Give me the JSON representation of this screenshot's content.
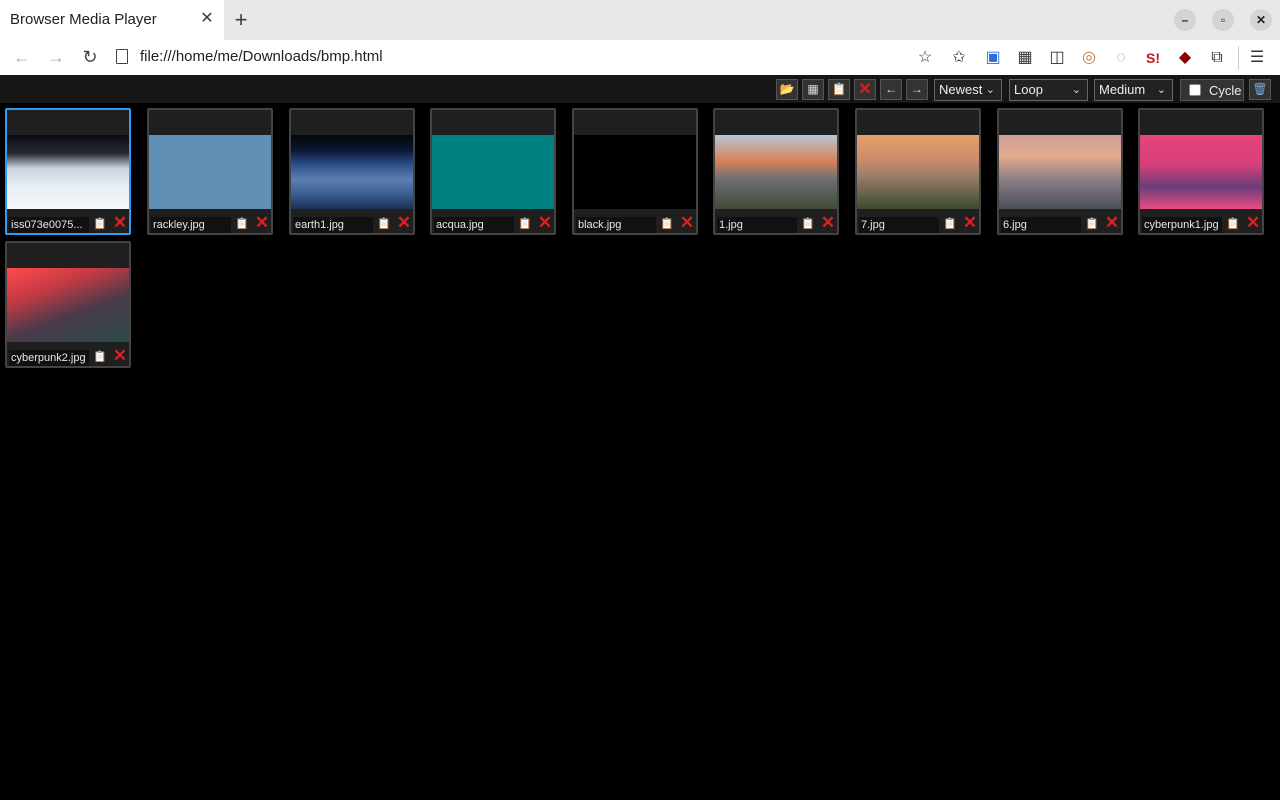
{
  "browser": {
    "tab_title": "Browser Media Player",
    "tab_close": "✕",
    "new_tab": "+",
    "url": "file:///home/me/Downloads/bmp.html",
    "window": {
      "minimize": "–",
      "maximize": "▫",
      "close": "✕"
    },
    "nav": {
      "back": "←",
      "forward": "→",
      "reload": "↻"
    },
    "extensions": [
      "☆",
      "✩",
      "▣",
      "▦",
      "◫",
      "◎",
      "◌",
      "S!",
      "◆",
      "⧉",
      "☰"
    ]
  },
  "controls": {
    "open_folder_icon": "📂",
    "grid_icon": "▦",
    "clipboard_icon": "📋",
    "clear_icon": "✕",
    "prev_icon": "←",
    "next_icon": "→",
    "sort": "Newest",
    "mode": "Loop",
    "size": "Medium",
    "cycle_label": "Cycle",
    "trash_icon": "🗑"
  },
  "thumbnails": [
    {
      "name": "iss073e0075...",
      "selected": true,
      "fill": "linear-gradient(180deg,#0a0a14 0%,#2a2a33 25%,#c9d3e0 45%,#e9eef5 70%,#f3f6fa 100%)"
    },
    {
      "name": "rackley.jpg",
      "fill": "#5f8fb4"
    },
    {
      "name": "earth1.jpg",
      "fill": "linear-gradient(180deg,#05070d 0%,#0a1530 20%,#2d4f8a 40%,#5e7fb3 60%,#3a5c8f 80%,#1c2f55 100%)"
    },
    {
      "name": "acqua.jpg",
      "fill": "#008080"
    },
    {
      "name": "black.jpg",
      "fill": "#000000"
    },
    {
      "name": "1.jpg",
      "fill": "linear-gradient(180deg,#b7c6d6 0%,#d9825a 35%,#6c6f73 60%,#3f4a36 100%)"
    },
    {
      "name": "7.jpg",
      "fill": "linear-gradient(180deg,#e7a06a 0%,#c98a6a 35%,#9b7f6a 55%,#3b4a2e 100%)"
    },
    {
      "name": "6.jpg",
      "fill": "linear-gradient(180deg,#d0a09a 0%,#e3a98a 30%,#8c7e86 60%,#4b4f58 100%)"
    },
    {
      "name": "cyberpunk1.jpg",
      "fill": "linear-gradient(180deg,#e8447a 0%,#d63f7a 40%,#6a3e7a 70%,#ea4a82 100%)"
    },
    {
      "name": "cyberpunk2.jpg",
      "fill": "linear-gradient(160deg,#ff4a4a 0%,#c43a44 30%,#4a3a4a 60%,#2b4a4a 100%)"
    }
  ]
}
